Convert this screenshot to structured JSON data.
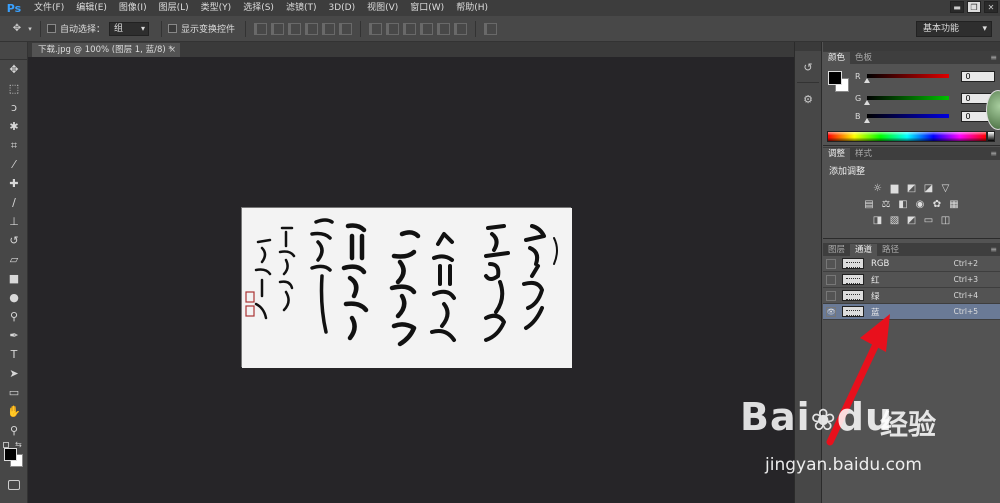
{
  "app": {
    "logo": "Ps",
    "menu": [
      "文件(F)",
      "编辑(E)",
      "图像(I)",
      "图层(L)",
      "类型(Y)",
      "选择(S)",
      "滤镜(T)",
      "3D(D)",
      "视图(V)",
      "窗口(W)",
      "帮助(H)"
    ],
    "window_controls": [
      "▬",
      "❐",
      "✕"
    ]
  },
  "options_bar": {
    "auto_select_label": "自动选择：",
    "auto_select_value": "组",
    "show_transform_label": "显示变换控件",
    "workspace": "基本功能"
  },
  "document": {
    "tab_title": "下载.jpg @ 100% (图层 1, 蓝/8) *",
    "tab_close": "×"
  },
  "color_panel": {
    "tabs": [
      "颜色",
      "色板"
    ],
    "sliders": [
      {
        "label": "R",
        "value": "0",
        "color": "#e00000"
      },
      {
        "label": "G",
        "value": "0",
        "color": "#00c000"
      },
      {
        "label": "B",
        "value": "0",
        "color": "#0000e0"
      }
    ]
  },
  "adjustments_panel": {
    "tabs": [
      "调整",
      "样式"
    ],
    "title": "添加调整"
  },
  "channels_panel": {
    "tabs": [
      "图层",
      "通道",
      "路径"
    ],
    "channels": [
      {
        "name": "RGB",
        "shortcut": "Ctrl+2",
        "visible": false,
        "selected": false
      },
      {
        "name": "红",
        "shortcut": "Ctrl+3",
        "visible": false,
        "selected": false
      },
      {
        "name": "绿",
        "shortcut": "Ctrl+4",
        "visible": false,
        "selected": false
      },
      {
        "name": "蓝",
        "shortcut": "Ctrl+5",
        "visible": true,
        "selected": true
      }
    ]
  },
  "watermark": {
    "brand": "Bai",
    "brand2": "du",
    "cn": "经验",
    "url": "jingyan.baidu.com"
  },
  "colors": {
    "accent": "#39a1ff",
    "selection": "#6a7a96",
    "arrow": "#e8101c"
  }
}
